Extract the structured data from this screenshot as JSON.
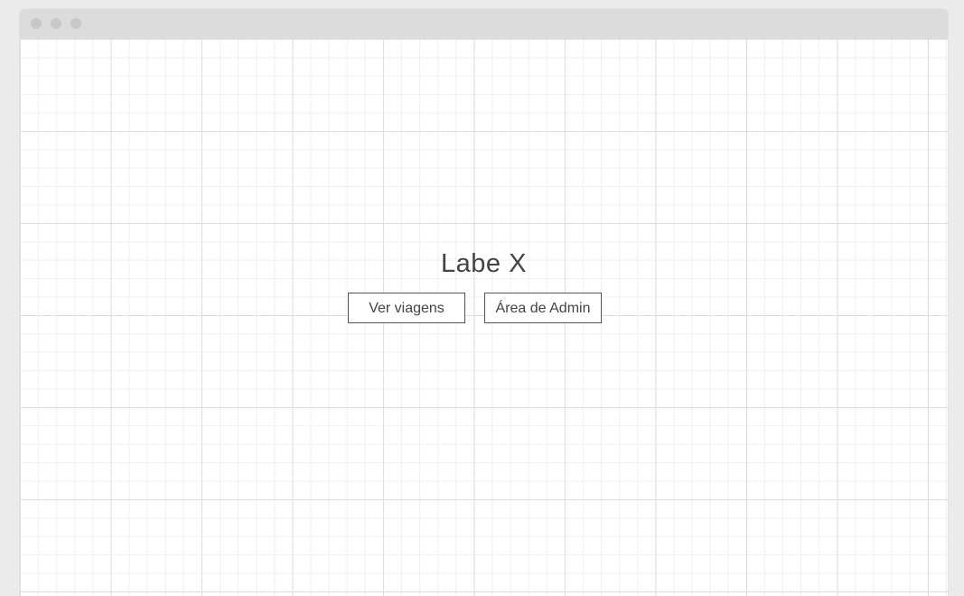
{
  "main": {
    "title": "Labe X",
    "buttons": [
      {
        "label": "Ver viagens"
      },
      {
        "label": "Área de Admin"
      }
    ]
  }
}
